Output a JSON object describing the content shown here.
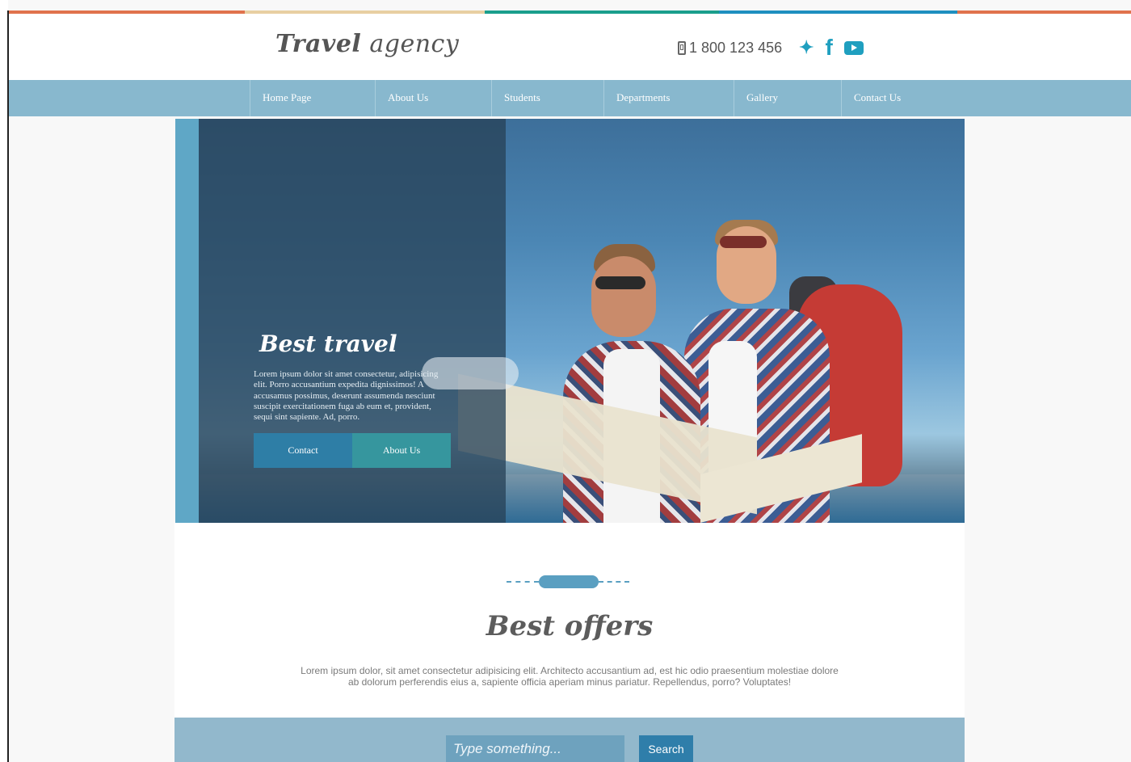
{
  "colors": {
    "accent": "#1f9fbf",
    "nav_bg": "#88b8ce",
    "strip": [
      "#e0734d",
      "#e8cfa2",
      "#1a9e8c",
      "#1f8fbf",
      "#e0734d"
    ]
  },
  "header": {
    "logo_bold": "Travel",
    "logo_rest": " agency",
    "phone": "1 800 123 456",
    "social_icons": [
      "twitter-icon",
      "facebook-icon",
      "youtube-icon"
    ]
  },
  "nav": {
    "items": [
      {
        "label": "Home Page"
      },
      {
        "label": "About Us"
      },
      {
        "label": "Students"
      },
      {
        "label": "Departments"
      },
      {
        "label": "Gallery"
      },
      {
        "label": "Contact Us"
      }
    ]
  },
  "hero": {
    "title": "Best travel",
    "text": "Lorem ipsum dolor sit amet consectetur, adipisicing elit. Porro accusantium expedita dignissimos! A accusamus possimus, deserunt assumenda nesciunt suscipit exercitationem fuga ab eum et, provident, sequi sint sapiente. Ad, porro.",
    "btn_contact": "Contact",
    "btn_about": "About Us"
  },
  "offers": {
    "title": "Best offers",
    "text": "Lorem ipsum dolor, sit amet consectetur adipisicing elit. Architecto accusantium ad, est hic odio praesentium molestiae dolore ab dolorum perferendis eius a, sapiente officia aperiam minus pariatur. Repellendus, porro? Voluptates!"
  },
  "search": {
    "placeholder": "Type something...",
    "button": "Search"
  }
}
